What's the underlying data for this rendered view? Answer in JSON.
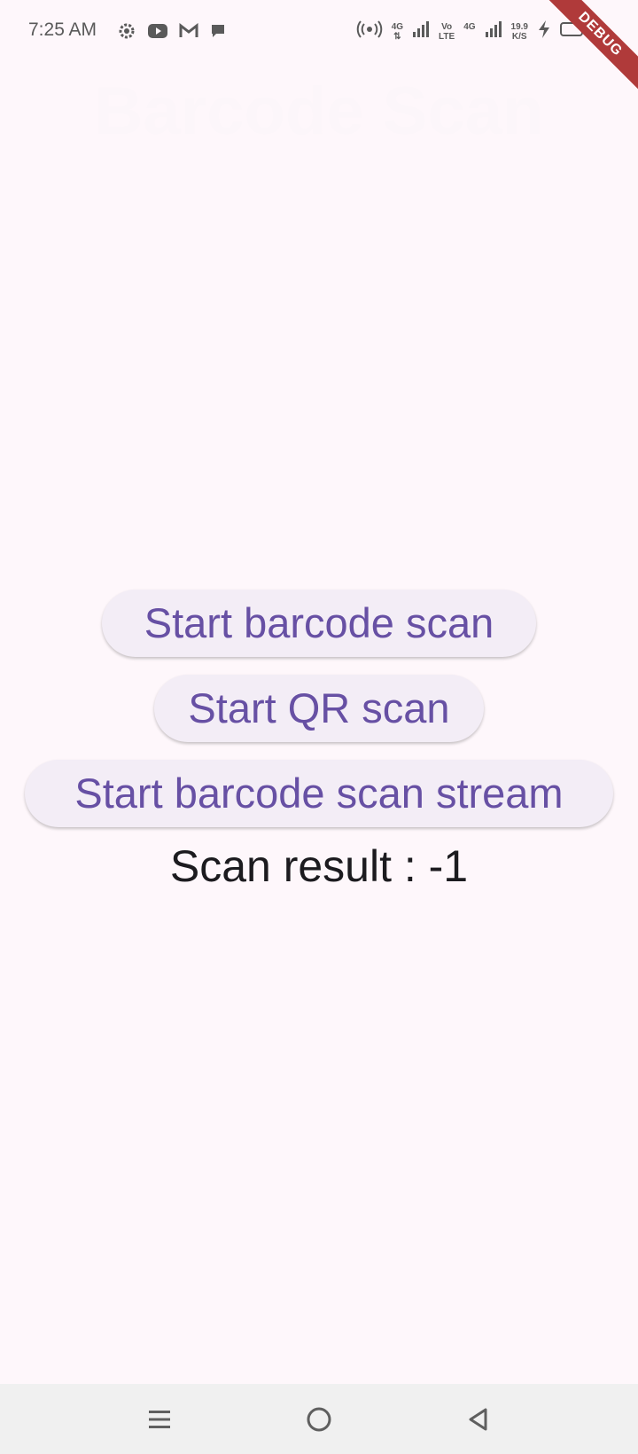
{
  "status_bar": {
    "time": "7:25 AM",
    "net_4g_1": "4G",
    "volte_top": "Vo",
    "volte_bottom": "LTE",
    "net_4g_2": "4G",
    "speed_value": "19.9",
    "speed_unit": "K/S",
    "icons": [
      "settings-icon",
      "youtube-icon",
      "gmail-icon",
      "chat-icon",
      "hotspot-icon",
      "signal-icon",
      "charging-icon",
      "battery-icon"
    ]
  },
  "debug_banner": {
    "label": "DEBUG",
    "color": "#B03A3A"
  },
  "app": {
    "title": "Barcode Scan",
    "buttons": {
      "barcode": "Start barcode scan",
      "qr": "Start QR scan",
      "stream": "Start barcode scan stream"
    },
    "scan_result": "Scan result : -1"
  },
  "colors": {
    "background": "#FEF7FB",
    "button_bg": "#F3EDF6",
    "accent": "#6750A4",
    "text": "#1C1B1F"
  },
  "nav_bar": {
    "icons": [
      "menu-icon",
      "home-icon",
      "back-icon"
    ]
  }
}
